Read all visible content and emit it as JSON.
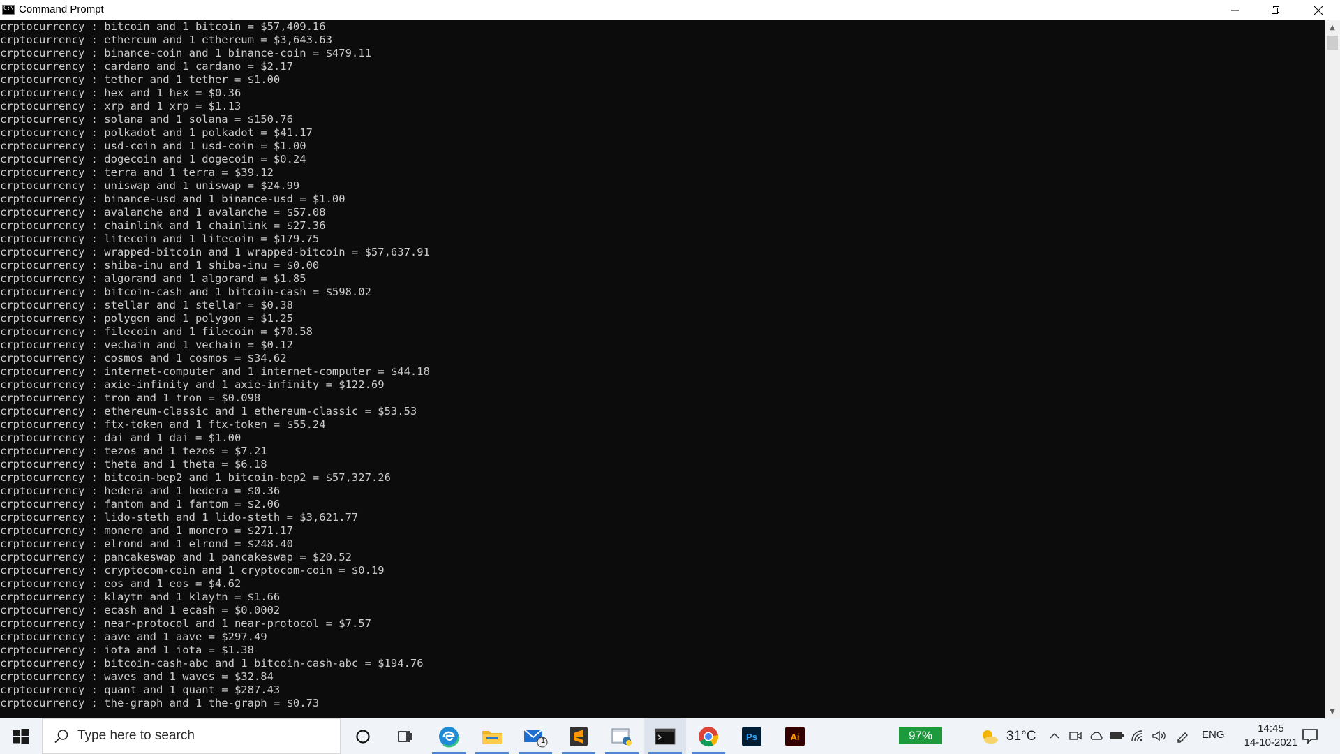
{
  "window": {
    "title": "Command Prompt"
  },
  "console": {
    "lines": [
      "crptocurrency : bitcoin and 1 bitcoin = $57,409.16",
      "crptocurrency : ethereum and 1 ethereum = $3,643.63",
      "crptocurrency : binance-coin and 1 binance-coin = $479.11",
      "crptocurrency : cardano and 1 cardano = $2.17",
      "crptocurrency : tether and 1 tether = $1.00",
      "crptocurrency : hex and 1 hex = $0.36",
      "crptocurrency : xrp and 1 xrp = $1.13",
      "crptocurrency : solana and 1 solana = $150.76",
      "crptocurrency : polkadot and 1 polkadot = $41.17",
      "crptocurrency : usd-coin and 1 usd-coin = $1.00",
      "crptocurrency : dogecoin and 1 dogecoin = $0.24",
      "crptocurrency : terra and 1 terra = $39.12",
      "crptocurrency : uniswap and 1 uniswap = $24.99",
      "crptocurrency : binance-usd and 1 binance-usd = $1.00",
      "crptocurrency : avalanche and 1 avalanche = $57.08",
      "crptocurrency : chainlink and 1 chainlink = $27.36",
      "crptocurrency : litecoin and 1 litecoin = $179.75",
      "crptocurrency : wrapped-bitcoin and 1 wrapped-bitcoin = $57,637.91",
      "crptocurrency : shiba-inu and 1 shiba-inu = $0.00",
      "crptocurrency : algorand and 1 algorand = $1.85",
      "crptocurrency : bitcoin-cash and 1 bitcoin-cash = $598.02",
      "crptocurrency : stellar and 1 stellar = $0.38",
      "crptocurrency : polygon and 1 polygon = $1.25",
      "crptocurrency : filecoin and 1 filecoin = $70.58",
      "crptocurrency : vechain and 1 vechain = $0.12",
      "crptocurrency : cosmos and 1 cosmos = $34.62",
      "crptocurrency : internet-computer and 1 internet-computer = $44.18",
      "crptocurrency : axie-infinity and 1 axie-infinity = $122.69",
      "crptocurrency : tron and 1 tron = $0.098",
      "crptocurrency : ethereum-classic and 1 ethereum-classic = $53.53",
      "crptocurrency : ftx-token and 1 ftx-token = $55.24",
      "crptocurrency : dai and 1 dai = $1.00",
      "crptocurrency : tezos and 1 tezos = $7.21",
      "crptocurrency : theta and 1 theta = $6.18",
      "crptocurrency : bitcoin-bep2 and 1 bitcoin-bep2 = $57,327.26",
      "crptocurrency : hedera and 1 hedera = $0.36",
      "crptocurrency : fantom and 1 fantom = $2.06",
      "crptocurrency : lido-steth and 1 lido-steth = $3,621.77",
      "crptocurrency : monero and 1 monero = $271.17",
      "crptocurrency : elrond and 1 elrond = $248.40",
      "crptocurrency : pancakeswap and 1 pancakeswap = $20.52",
      "crptocurrency : cryptocom-coin and 1 cryptocom-coin = $0.19",
      "crptocurrency : eos and 1 eos = $4.62",
      "crptocurrency : klaytn and 1 klaytn = $1.66",
      "crptocurrency : ecash and 1 ecash = $0.0002",
      "crptocurrency : near-protocol and 1 near-protocol = $7.57",
      "crptocurrency : aave and 1 aave = $297.49",
      "crptocurrency : iota and 1 iota = $1.38",
      "crptocurrency : bitcoin-cash-abc and 1 bitcoin-cash-abc = $194.76",
      "crptocurrency : waves and 1 waves = $32.84",
      "crptocurrency : quant and 1 quant = $287.43",
      "crptocurrency : the-graph and 1 the-graph = $0.73"
    ]
  },
  "taskbar": {
    "search_placeholder": "Type here to search",
    "mail_badge": "1",
    "battery_label": "97%",
    "temperature": "31°C",
    "language": "ENG",
    "time": "14:45",
    "date": "14-10-2021",
    "colors": {
      "battery": "#1d9a3c",
      "accent": "#4f86d1"
    }
  }
}
